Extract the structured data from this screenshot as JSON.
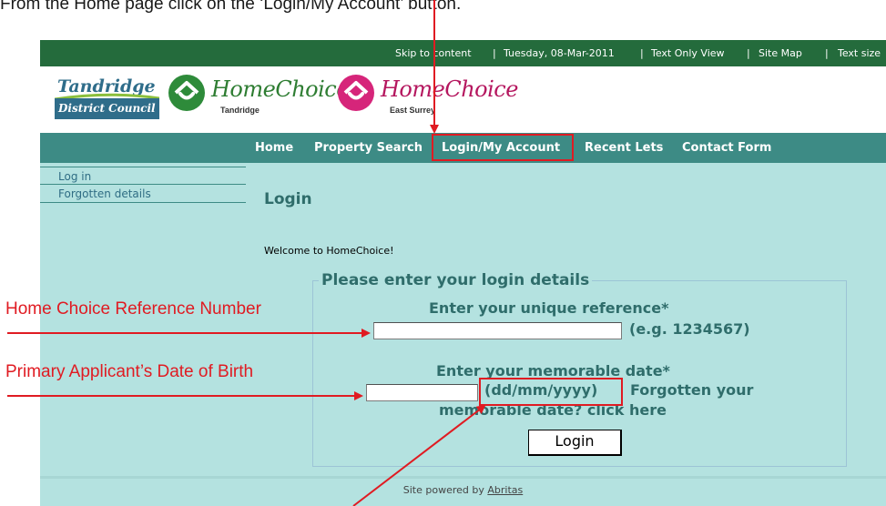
{
  "instruction": "From the Home page click on the ‘Login/My Account’ button.",
  "topbar": {
    "skip": "Skip to content",
    "date": "Tuesday, 08-Mar-2011",
    "text_only": "Text Only View",
    "sitemap": "Site Map",
    "text_size": "Text size",
    "separator": "|"
  },
  "logos": {
    "tdc_line1": "Tandridge",
    "tdc_line2": "District Council",
    "hc1_word": "HomeChoice",
    "hc1_sub": "Tandridge",
    "hc2_word": "HomeChoice",
    "hc2_sub": "East Surrey"
  },
  "nav": {
    "items": [
      "Home",
      "Property Search",
      "Login/My Account",
      "Recent Lets",
      "Contact Form"
    ]
  },
  "sidebar": {
    "items": [
      "Log in",
      "Forgotten details"
    ]
  },
  "main": {
    "title": "Login",
    "welcome": "Welcome to HomeChoice!",
    "legend": "Please enter your login details",
    "ref_label": "Enter your unique reference*",
    "ref_example": "(e.g. 1234567)",
    "ref_value": "",
    "date_label": "Enter your memorable date*",
    "date_format": "(dd/mm/yyyy)",
    "forgot_line1": "Forgotten your",
    "forgot_line2": "memorable date? click here",
    "date_value": "",
    "login_button": "Login"
  },
  "footer": {
    "text": "Site powered by ",
    "link": "Abritas"
  },
  "annotations": {
    "ref_number": "Home Choice Reference Number",
    "dob": "Primary Applicant’s Date of Birth"
  },
  "colors": {
    "annotation": "#e01b22",
    "topbar": "#246b3c",
    "nav": "#3d8b85",
    "content_bg": "#b4e2e0",
    "heading": "#2f6d6b"
  }
}
